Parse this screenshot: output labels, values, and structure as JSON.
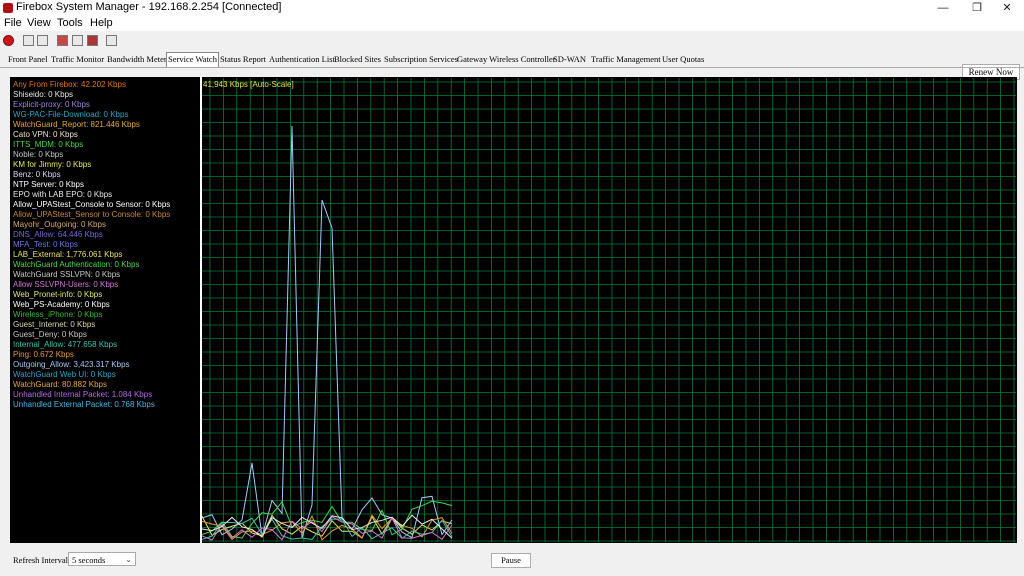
{
  "window": {
    "title": "Firebox System Manager - 192.168.2.254 [Connected]",
    "minimize": "—",
    "maximize": "❐",
    "close": "✕"
  },
  "menu": {
    "items": [
      "File",
      "View",
      "Tools",
      "Help"
    ]
  },
  "toolbar": {
    "renew_label": "Renew Now"
  },
  "tabs": [
    "Front Panel",
    "Traffic Monitor",
    "Bandwidth Meter",
    "Service Watch",
    "Status Report",
    "Authentication List",
    "Blocked Sites",
    "Subscription Services",
    "Gateway Wireless Controller",
    "SD-WAN",
    "Traffic Management",
    "User Quotas"
  ],
  "active_tab": "Service Watch",
  "legend": [
    {
      "text": "Any From Firebox: 42.202 Kbps",
      "color": "#e07818"
    },
    {
      "text": "Shiseido: 0 Kbps",
      "color": "#e8e8e8"
    },
    {
      "text": "Explicit-proxy: 0 Kbps",
      "color": "#9a86e0"
    },
    {
      "text": "WG-PAC-File-Download: 0 Kbps",
      "color": "#28a8c8"
    },
    {
      "text": "WatchGuard_Report: 821.446 Kbps",
      "color": "#e8a838"
    },
    {
      "text": "Cato VPN: 0 Kbps",
      "color": "#f0e0c8"
    },
    {
      "text": "ITTS_MDM: 0 Kbps",
      "color": "#48d848"
    },
    {
      "text": "Noble: 0 Kbps",
      "color": "#c8c8c8"
    },
    {
      "text": "KM for Jimmy: 0 Kbps",
      "color": "#e8e850"
    },
    {
      "text": "Benz: 0 Kbps",
      "color": "#d8d8f8"
    },
    {
      "text": "NTP Server: 0 Kbps",
      "color": "#ffffff"
    },
    {
      "text": "EPO with LAB EPO: 0 Kbps",
      "color": "#e8e8e8"
    },
    {
      "text": "Allow_UPAStest_Console to Sensor: 0 Kbps",
      "color": "#ffffff"
    },
    {
      "text": "Allow_UPAStest_Sensor to Console: 0 Kbps",
      "color": "#c88838"
    },
    {
      "text": "Mayohr_Outgoing: 0 Kbps",
      "color": "#d8a868"
    },
    {
      "text": "DNS_Allow: 64.446 Kbps",
      "color": "#7868d8"
    },
    {
      "text": "MFA_Test: 0 Kbps",
      "color": "#6878e8"
    },
    {
      "text": "LAB_External: 1,776.061 Kbps",
      "color": "#e8e068"
    },
    {
      "text": "WatchGuard Authentication: 0 Kbps",
      "color": "#48d848"
    },
    {
      "text": "WatchGuard SSLVPN: 0 Kbps",
      "color": "#c8c8c8"
    },
    {
      "text": "Allow SSLVPN-Users: 0 Kbps",
      "color": "#d878d8"
    },
    {
      "text": "Web_Pronet-info: 0 Kbps",
      "color": "#e8e868"
    },
    {
      "text": "Web_PS-Academy: 0 Kbps",
      "color": "#ffffff"
    },
    {
      "text": "Wireless_iPhone: 0 Kbps",
      "color": "#38b838"
    },
    {
      "text": "Guest_Internet: 0 Kbps",
      "color": "#d8d8a8"
    },
    {
      "text": "Guest_Deny: 0 Kbps",
      "color": "#c8c8c8"
    },
    {
      "text": "Internal_Allow: 477.658 Kbps",
      "color": "#38c8a8"
    },
    {
      "text": "Ping: 0.672 Kbps",
      "color": "#e89838"
    },
    {
      "text": "Outgoing_Allow: 3,423.317 Kbps",
      "color": "#a8c8f8"
    },
    {
      "text": "WatchGuard Web UI: 0 Kbps",
      "color": "#28a8c8"
    },
    {
      "text": "WatchGuard: 80.882 Kbps",
      "color": "#e8a838"
    },
    {
      "text": "Unhandled Internal Packet: 1.084 Kbps",
      "color": "#b868e8"
    },
    {
      "text": "Unhandled External Packet: 0.768 Kbps",
      "color": "#48b8e8"
    }
  ],
  "graph": {
    "scale_label": "41,943 Kbps [Auto-Scale]",
    "grid_color": "#0f7a3a"
  },
  "bottom": {
    "refresh_label": "Refresh Interval:",
    "refresh_value": "5 seconds",
    "pause_label": "Pause"
  }
}
